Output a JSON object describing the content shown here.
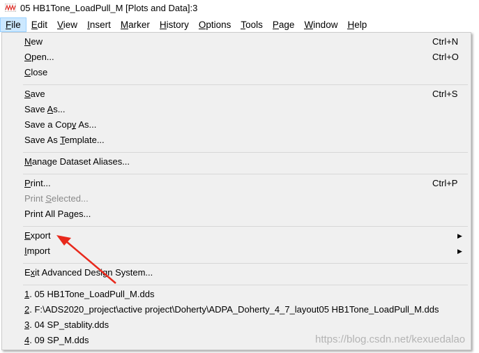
{
  "window": {
    "title": "05 HB1Tone_LoadPull_M [Plots and Data]:3",
    "icon": "waveform-app-icon"
  },
  "menubar": [
    {
      "label": "File",
      "key": 0,
      "active": true
    },
    {
      "label": "Edit",
      "key": 0
    },
    {
      "label": "View",
      "key": 0
    },
    {
      "label": "Insert",
      "key": 0
    },
    {
      "label": "Marker",
      "key": 0
    },
    {
      "label": "History",
      "key": 0
    },
    {
      "label": "Options",
      "key": 0
    },
    {
      "label": "Tools",
      "key": 0
    },
    {
      "label": "Page",
      "key": 0
    },
    {
      "label": "Window",
      "key": 0
    },
    {
      "label": "Help",
      "key": 0
    }
  ],
  "file_menu": [
    {
      "label": "New",
      "key": 0,
      "shortcut": "Ctrl+N"
    },
    {
      "label": "Open...",
      "key": 0,
      "shortcut": "Ctrl+O"
    },
    {
      "label": "Close",
      "key": 0
    },
    {
      "separator": true
    },
    {
      "label": "Save",
      "key": 0,
      "shortcut": "Ctrl+S"
    },
    {
      "label": "Save As...",
      "key": 5
    },
    {
      "label": "Save a Copy As...",
      "key": 10
    },
    {
      "label": "Save As Template...",
      "key": 8
    },
    {
      "separator": true
    },
    {
      "label": "Manage Dataset Aliases...",
      "key": 0
    },
    {
      "separator": true
    },
    {
      "label": "Print...",
      "key": 0,
      "shortcut": "Ctrl+P"
    },
    {
      "label": "Print Selected...",
      "key": 6,
      "disabled": true
    },
    {
      "label": "Print All Pages...",
      "key": -1
    },
    {
      "separator": true
    },
    {
      "label": "Export",
      "key": 0,
      "submenu": true
    },
    {
      "label": "Import",
      "key": 0,
      "submenu": true
    },
    {
      "separator": true
    },
    {
      "label": "Exit Advanced Design System...",
      "key": 1
    },
    {
      "separator": true
    },
    {
      "label": "1. 05 HB1Tone_LoadPull_M.dds",
      "key": 0
    },
    {
      "label": "2. F:\\ADS2020_project\\active project\\Doherty\\ADPA_Doherty_4_7_layout05 HB1Tone_LoadPull_M.dds",
      "key": 0
    },
    {
      "label": "3. 04 SP_stablity.dds",
      "key": 0
    },
    {
      "label": "4. 09 SP_M.dds",
      "key": 0
    }
  ],
  "annotation": {
    "type": "arrow",
    "color": "#e8291c",
    "points_to": "Export"
  },
  "watermark": "https://blog.csdn.net/kexuedalao"
}
